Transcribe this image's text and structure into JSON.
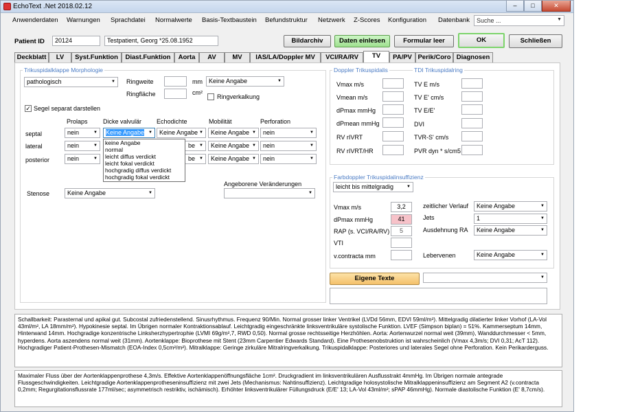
{
  "window": {
    "title": "EchoText .Net 2018.02.12",
    "minimize": "–",
    "maximize": "□",
    "close": "✕"
  },
  "menu": [
    "Anwenderdaten",
    "Warnungen",
    "Sprachdatei",
    "Normalwerte",
    "Basis-Textbaustein",
    "Befundstruktur",
    "Netzwerk",
    "Z-Scores",
    "Konfiguration",
    "Datenbank"
  ],
  "search": {
    "value": "Suche ..."
  },
  "patient": {
    "label": "Patient ID",
    "id": "20124",
    "name": "Testpatient, Georg *25.08.1952"
  },
  "buttons": {
    "bildarchiv": "Bildarchiv",
    "daten": "Daten einlesen",
    "formular": "Formular leer",
    "ok": "OK",
    "schliessen": "Schließen",
    "eigene": "Eigene Texte"
  },
  "tabs": [
    "Deckblatt",
    "LV",
    "Syst.Funktion",
    "Diast.Funktion",
    "Aorta",
    "AV",
    "MV",
    "IAS/LA/Doppler MV",
    "VCI/RA/RV",
    "TV",
    "PA/PV",
    "Perik/Coro",
    "Diagnosen"
  ],
  "morph": {
    "group": "Trikuspidalklappe Morphologie",
    "status": "pathologisch",
    "ringweite_label": "Ringweite",
    "ringweite_unit": "mm",
    "ringweite_select": "Keine Angabe",
    "ringflaeche_label": "Ringfläche",
    "ringflaeche_unit": "cm²",
    "ringverkalkung": "Ringverkalkung",
    "segel_separat": "Segel separat darstellen",
    "segel_checked": "✓",
    "columns": [
      "Prolaps",
      "Dicke valvulär",
      "Echodichte",
      "Mobilität",
      "Perforation"
    ],
    "rows": [
      {
        "label": "septal",
        "prolaps": "nein",
        "dicke": "Keine Angabe",
        "echo": "Keine Angabe",
        "mobil": "Keine Angabe",
        "perf": "nein"
      },
      {
        "label": "lateral",
        "prolaps": "nein",
        "dicke": "",
        "echo": "Keine Angabe",
        "mobil": "Keine Angabe",
        "perf": "nein"
      },
      {
        "label": "posterior",
        "prolaps": "nein",
        "dicke": "",
        "echo": "Keine Angabe",
        "mobil": "Keine Angabe",
        "perf": "nein"
      }
    ],
    "dropdown_options": [
      "keine Angabe",
      "normal",
      "leicht diffus verdickt",
      "leicht fokal verdickt",
      "hochgradig diffus verdickt",
      "hochgradig fokal verdickt"
    ],
    "echo_partial": "be",
    "stenose_label": "Stenose",
    "stenose_value": "Keine Angabe",
    "angeboren_label": "Angeborene Veränderungen",
    "angeboren_value": ""
  },
  "doppler": {
    "group": "Doppler Trikuspidalis",
    "labels": [
      "Vmax m/s",
      "Vmean m/s",
      "dPmax mmHg",
      "dPmean mmHg",
      "RV rIVRT",
      "RV rIVRT/HR"
    ]
  },
  "tdi": {
    "group": "TDI Trikuspidalring",
    "labels": [
      "TV E m/s",
      "TV E' cm/s",
      "TV E/E'",
      "DVI",
      "TVR-S' cm/s",
      "PVR dyn * s/cm5"
    ]
  },
  "farb": {
    "group": "Farbdoppler Trikuspidalinsuffizienz",
    "grade": "leicht bis mittelgradig",
    "vmax_label": "Vmax m/s",
    "vmax": "3,2",
    "dpmax_label": "dPmax mmHg",
    "dpmax": "41",
    "rap_label": "RAP (s. VCI/RA/RV)",
    "rap": "5",
    "vti_label": "VTI",
    "vc_label": "v.contracta mm",
    "verlauf_label": "zeitlicher Verlauf",
    "verlauf": "Keine Angabe",
    "jets_label": "Jets",
    "jets": "1",
    "ausdehnung_label": "Ausdehnung RA",
    "ausdehnung": "Keine Angabe",
    "leber_label": "Lebervenen",
    "leber": "Keine Angabe"
  },
  "eigene_select": "",
  "report1": "Schallbarkeit: Parasternal und apikal gut. Subcostal zufriedenstellend. Sinusrhythmus. Frequenz 90/Min. Normal grosser linker Ventrikel (LVDd 56mm, EDVI 59ml/m²). Mittelgradig dilatierter linker Vorhof (LA-Vol 43ml/m², LA 18mm/m²). Hypokinesie septal. Im Übrigen normaler Kontraktionsablauf. Leichtgradig eingeschränkte linksventrikuläre systolische Funktion. LVEF (Simpson biplan) = 51%. Kammerseptum 14mm, Hinterwand 14mm. Hochgradige konzentrische Linksherzhypertrophie (LVMI 69g/m²,7, RWD 0,50). Normal grosse rechtsseitige Herzhöhlen. Aorta: Aortenwurzel normal weit (39mm), Wanddurchmesser < 5mm, hyperdens. Aorta aszendens normal weit (31mm). Aortenklappe: Bioprothese mit Stent (23mm Carpentier Edwards Standard). Eine Prothesenobstruktion ist wahrscheinlich (Vmax 4,3m/s; DVI 0,31; AcT 112). Hochgradiger Patient-Prothesen-Mismatch (EOA-Index 0,5cm²/m²). Mitralklappe: Geringe zirkuläre Mitralringverkalkung. Trikuspidalklappe: Posteriores und laterales Segel ohne Perforation. Kein Perikarderguss.",
  "report2": "Maximaler Fluss über der Aortenklappenprothese 4,3m/s. Effektive Aortenklappenöffnungsfläche 1cm². Druckgradient im linksventrikulären Ausflusstrakt 4mmHg. Im Übrigen normale antegrade Flussgeschwindigkeiten. Leichtgradige  Aortenklappenprotheseninsuffizienz mit zwei Jets (Mechanismus: Nahtinsuffizienz). Leichtgradige holosystolische Mitralklappeninsuffizienz am Segment A2 (v.contracta 0,2mm; Regurgitationsflussrate 177ml/sec; asymmetrisch restriktiv, ischämisch). Erhöhter linksventrikulärer Füllungsdruck (E/E' 13; LA-Vol 43ml/m²; sPAP 46mmHg). Normale diastolische Funktion (E' 8,7cm/s)."
}
